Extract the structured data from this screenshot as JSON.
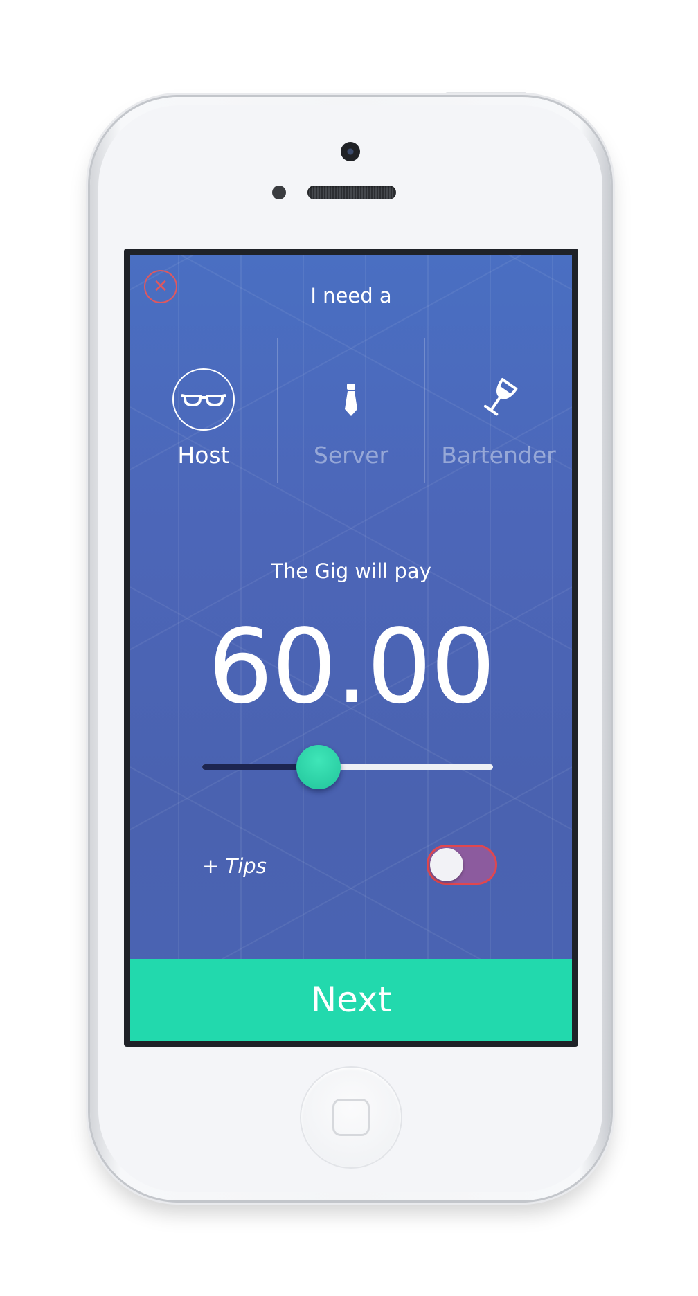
{
  "header": {
    "close_symbol": "✕",
    "title": "I need a"
  },
  "roles": [
    {
      "label": "Host",
      "icon": "glasses-icon",
      "selected": true
    },
    {
      "label": "Server",
      "icon": "tie-icon",
      "selected": false
    },
    {
      "label": "Bartender",
      "icon": "wine-glass-icon",
      "selected": false
    }
  ],
  "pay": {
    "label": "The Gig will pay",
    "amount": "60.00",
    "slider_fraction": 0.4
  },
  "tips": {
    "label": "+ Tips",
    "enabled": false
  },
  "next_button": {
    "label": "Next"
  },
  "colors": {
    "accent": "#22d9ad",
    "background": "#4b67b7",
    "close": "#e0585e",
    "toggle_border": "#e0474f"
  }
}
